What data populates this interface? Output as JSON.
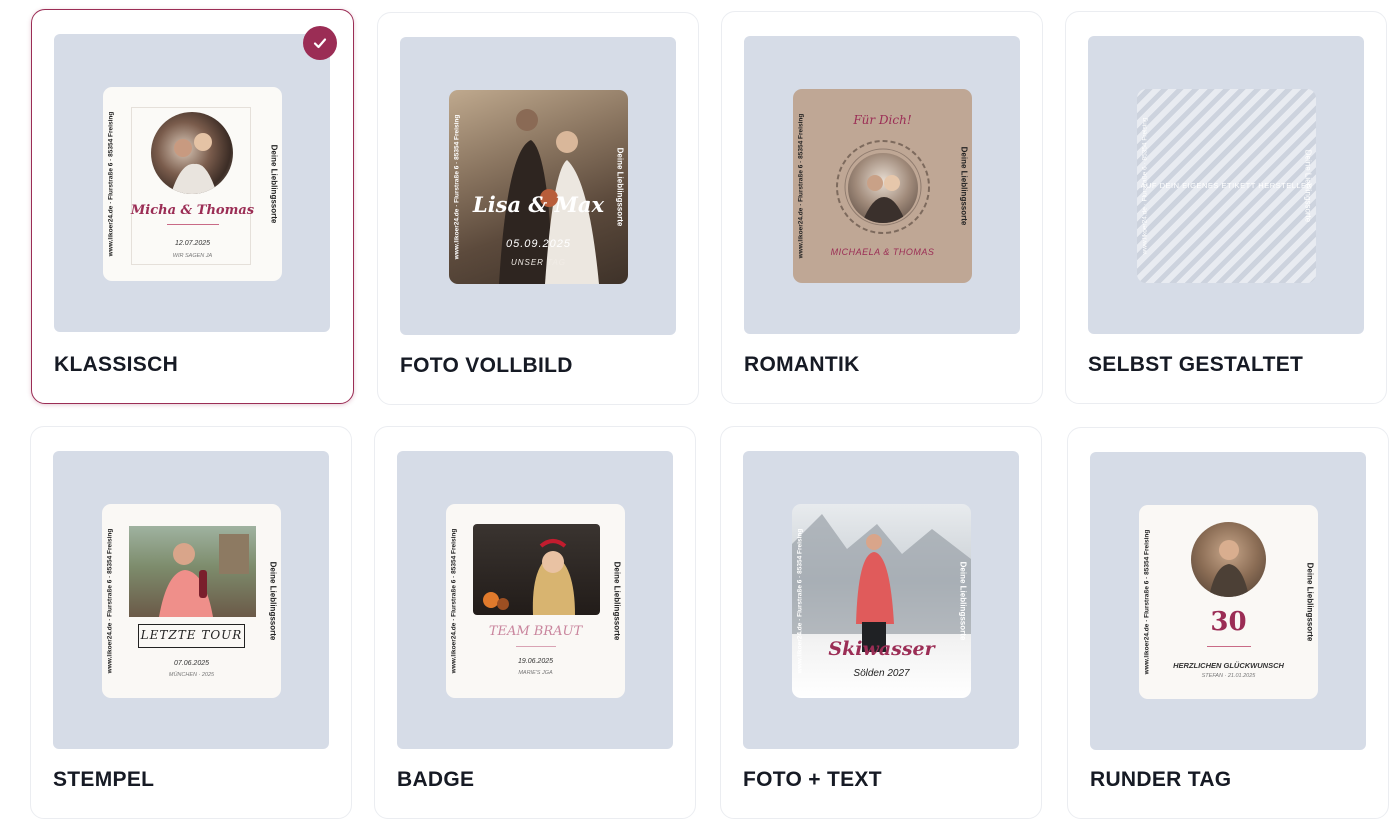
{
  "cards": [
    {
      "label": "KLASSISCH",
      "selected": true,
      "sidebar_left": "www.likoer24.de · Flurstraße 6 · 85354 Freising",
      "sidebar_right": "Deine Lieblingssorte",
      "names": "Micha & Thomas",
      "date": "12.07.2025",
      "subtitle": "WIR SAGEN JA"
    },
    {
      "label": "FOTO VOLLBILD",
      "sidebar_left": "www.likoer24.de · Flurstraße 6 · 85354 Freising",
      "sidebar_right": "Deine Lieblingssorte",
      "names": "Lisa & Max",
      "date": "05.09.2025",
      "subtitle": "UNSER TAG"
    },
    {
      "label": "ROMANTIK",
      "sidebar_left": "www.likoer24.de · Flurstraße 6 · 85354 Freising",
      "sidebar_right": "Deine Lieblingssorte",
      "top_text": "Für Dich!",
      "names": "MICHAELA & THOMAS"
    },
    {
      "label": "SELBST GESTALTET",
      "sidebar_left": "www.likoer24.de · Flurstraße 6 · 85354 Freising",
      "sidebar_right": "Deine Lieblingssorte",
      "center_text": "AUF DEIN EIGENES ETIKETT HERSTELLEN"
    },
    {
      "label": "STEMPEL",
      "sidebar_left": "www.likoer24.de · Flurstraße 6 · 85354 Freising",
      "sidebar_right": "Deine Lieblingssorte",
      "stamp_text": "LETZTE TOUR",
      "date": "07.06.2025",
      "subtitle": "MÜNCHEN · 2025"
    },
    {
      "label": "BADGE",
      "sidebar_left": "www.likoer24.de · Flurstraße 6 · 85354 Freising",
      "sidebar_right": "Deine Lieblingssorte",
      "title": "TEAM BRAUT",
      "date": "19.06.2025",
      "subtitle": "MARIE'S JGA"
    },
    {
      "label": "FOTO + TEXT",
      "sidebar_left": "www.likoer24.de · Flurstraße 6 · 85354 Freising",
      "sidebar_right": "Deine Lieblingssorte",
      "title": "Skiwasser",
      "subtitle": "Sölden 2027"
    },
    {
      "label": "RUNDER TAG",
      "sidebar_left": "www.likoer24.de · Flurstraße 6 · 85354 Freising",
      "sidebar_right": "Deine Lieblingssorte",
      "number": "30",
      "title": "HERZLICHEN GLÜCKWUNSCH",
      "subtitle": "STEFAN · 21.01.2025"
    }
  ],
  "colors": {
    "accent": "#9b2d55",
    "preview_bg": "#d6dce7",
    "label_text": "#161a24"
  },
  "icons": {
    "selected": "checkmark-icon"
  }
}
